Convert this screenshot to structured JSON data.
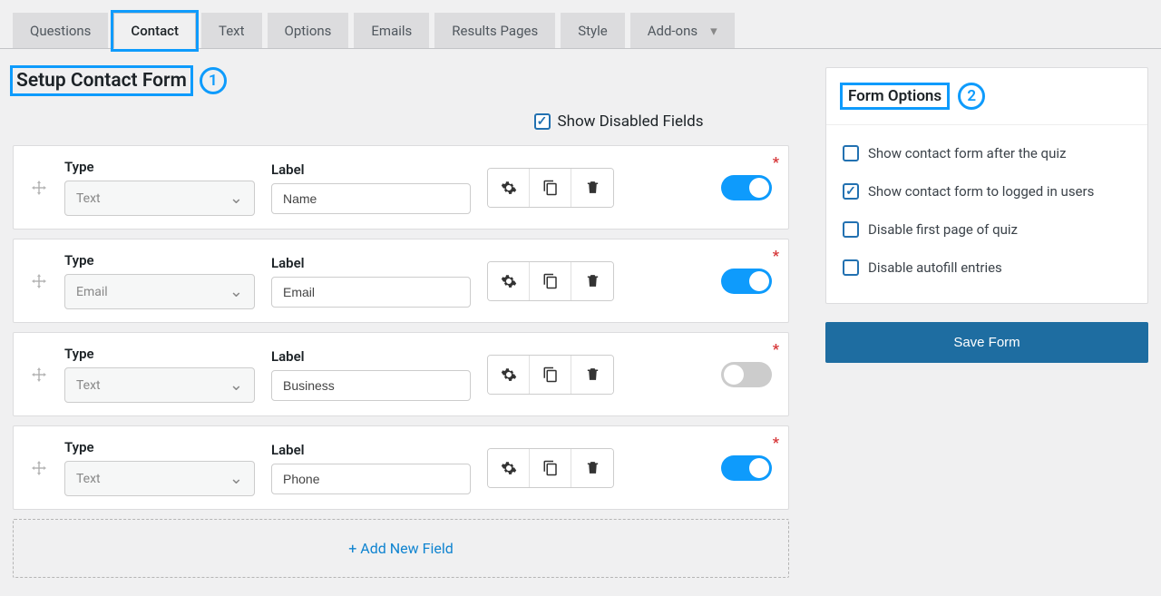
{
  "tabs": [
    {
      "label": "Questions",
      "active": false
    },
    {
      "label": "Contact",
      "active": true,
      "highlighted": true
    },
    {
      "label": "Text",
      "active": false
    },
    {
      "label": "Options",
      "active": false
    },
    {
      "label": "Emails",
      "active": false
    },
    {
      "label": "Results Pages",
      "active": false
    },
    {
      "label": "Style",
      "active": false
    },
    {
      "label": "Add-ons",
      "active": false,
      "has_dropdown": true
    }
  ],
  "page_title": "Setup Contact Form",
  "callout_1": "1",
  "show_disabled": {
    "label": "Show Disabled Fields",
    "checked": true
  },
  "type_header": "Type",
  "label_header": "Label",
  "fields": [
    {
      "type": "Text",
      "label": "Name",
      "enabled": true,
      "required": true
    },
    {
      "type": "Email",
      "label": "Email",
      "enabled": true,
      "required": true
    },
    {
      "type": "Text",
      "label": "Business",
      "enabled": false,
      "required": true
    },
    {
      "type": "Text",
      "label": "Phone",
      "enabled": true,
      "required": true
    }
  ],
  "add_field_label": "+ Add New Field",
  "form_options": {
    "title": "Form Options",
    "callout": "2",
    "items": [
      {
        "label": "Show contact form after the quiz",
        "checked": false
      },
      {
        "label": "Show contact form to logged in users",
        "checked": true
      },
      {
        "label": "Disable first page of quiz",
        "checked": false
      },
      {
        "label": "Disable autofill entries",
        "checked": false
      }
    ]
  },
  "save_button": "Save Form"
}
